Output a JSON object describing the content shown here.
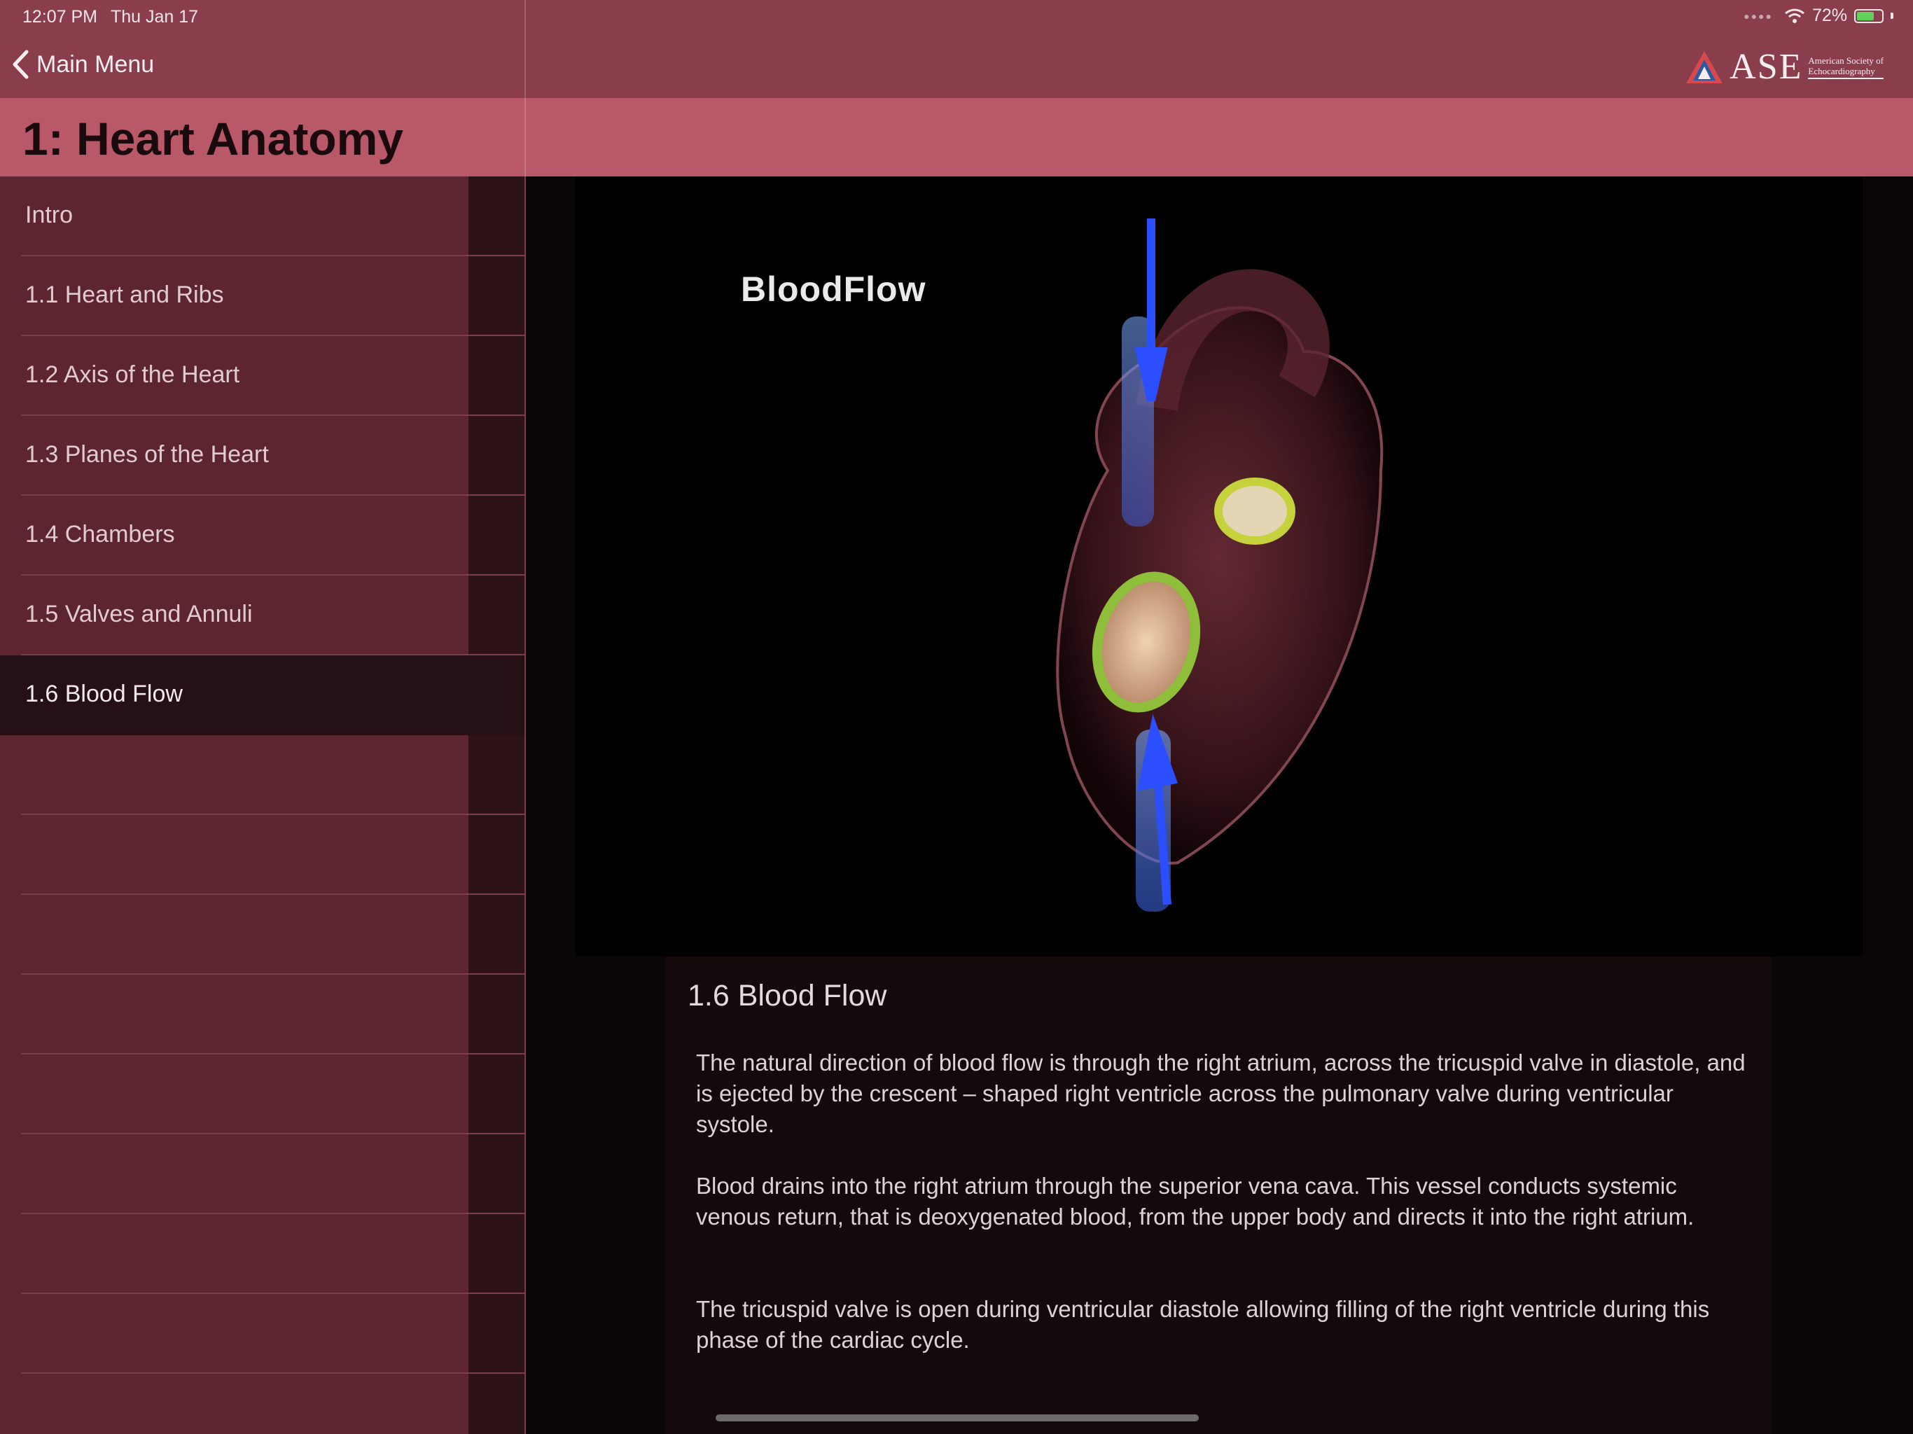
{
  "status_bar": {
    "time": "12:07 PM",
    "date": "Thu Jan 17",
    "battery": "72%",
    "battery_level": 0.72
  },
  "header": {
    "back_label": "Main Menu",
    "logo_text": "ASE",
    "logo_subtitle_1": "American Society of",
    "logo_subtitle_2": "Echocardiography"
  },
  "title": "1: Heart Anatomy",
  "sidebar": {
    "items": [
      {
        "label": "Intro"
      },
      {
        "label": "1.1 Heart and Ribs"
      },
      {
        "label": "1.2 Axis of the Heart"
      },
      {
        "label": "1.3 Planes of the Heart"
      },
      {
        "label": "1.4 Chambers"
      },
      {
        "label": "1.5 Valves and Annuli"
      },
      {
        "label": "1.6 Blood Flow",
        "selected": true
      }
    ]
  },
  "video": {
    "label": "BloodFlow"
  },
  "content": {
    "heading": "1.6 Blood Flow",
    "paragraphs": [
      "The natural direction of blood flow is through the right atrium, across the tricuspid valve in diastole, and is ejected by the crescent – shaped right ventricle across the pulmonary valve during ventricular systole.",
      "Blood drains into the right atrium through the superior vena cava. This vessel conducts systemic venous return, that is deoxygenated blood, from the upper body and directs it into the right atrium.",
      "The tricuspid valve is open during ventricular diastole allowing filling of the right ventricle during this phase of the cardiac cycle."
    ]
  },
  "colors": {
    "header": "#8a3e4c",
    "title_bar": "#b85868",
    "sidebar": "#5c2530",
    "selected_row": "#241015"
  }
}
